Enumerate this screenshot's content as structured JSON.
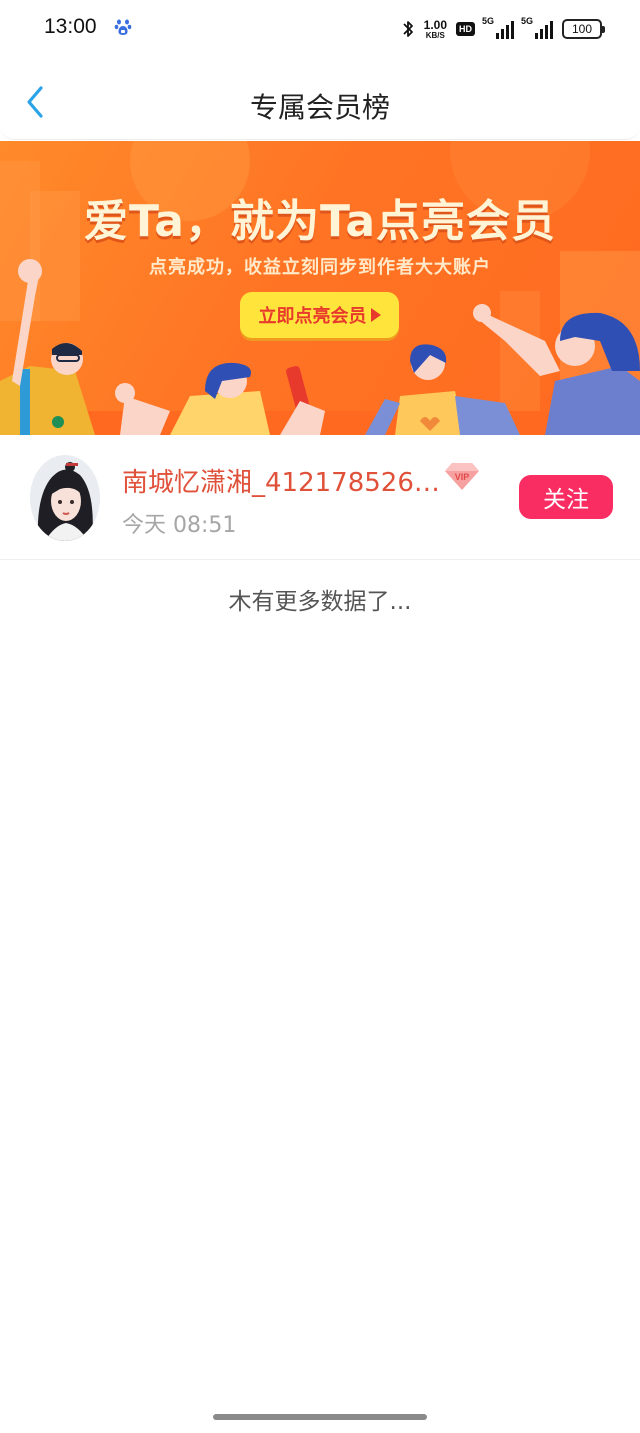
{
  "status_bar": {
    "time": "13:00",
    "app_icon": "baidu-paw-icon",
    "net_speed_value": "1.00",
    "net_speed_unit": "KB/S",
    "hd_label": "HD",
    "signal_1_label": "5G",
    "signal_2_label": "5G",
    "battery_level": "100"
  },
  "nav": {
    "back_icon": "chevron-left-icon",
    "title": "专属会员榜"
  },
  "banner": {
    "headline": "爱Ta，就为Ta点亮会员",
    "subtitle": "点亮成功，收益立刻同步到作者大大账户",
    "cta_label": "立即点亮会员",
    "colors": {
      "background": "#ff7424",
      "cta": "#ffe53b",
      "cta_text": "#e8392d"
    }
  },
  "members": [
    {
      "name": "南城忆潇湘_412178526…",
      "badge": "VIP",
      "time": "今天 08:51",
      "follow_label": "关注"
    }
  ],
  "footer": {
    "no_more_text": "木有更多数据了..."
  },
  "colors": {
    "accent_blue": "#2aa3e8",
    "follow_button": "#fa2d62",
    "member_name": "#e0513a"
  }
}
